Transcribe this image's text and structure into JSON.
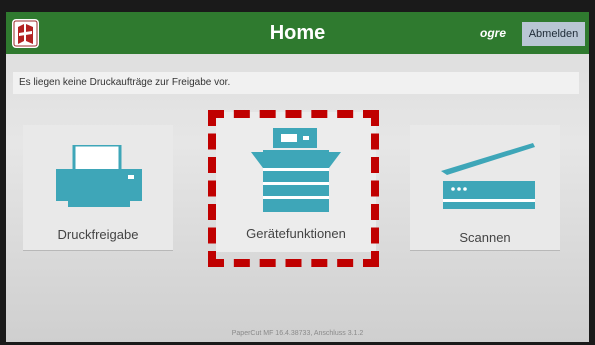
{
  "header": {
    "title": "Home",
    "username": "ogre",
    "logout_label": "Abmelden"
  },
  "message": "Es liegen keine Druckaufträge zur Freigabe vor.",
  "tiles": [
    {
      "label": "Druckfreigabe",
      "icon": "printer-icon"
    },
    {
      "label": "Gerätefunktionen",
      "icon": "copier-icon"
    },
    {
      "label": "Scannen",
      "icon": "scanner-icon"
    }
  ],
  "footer": "PaperCut MF 16.4.38733, Anschluss 3.1.2",
  "colors": {
    "header_bg": "#2f7a2f",
    "icon": "#3ea6b8",
    "highlight": "#c00000",
    "logout_bg": "#b9c6d4"
  }
}
